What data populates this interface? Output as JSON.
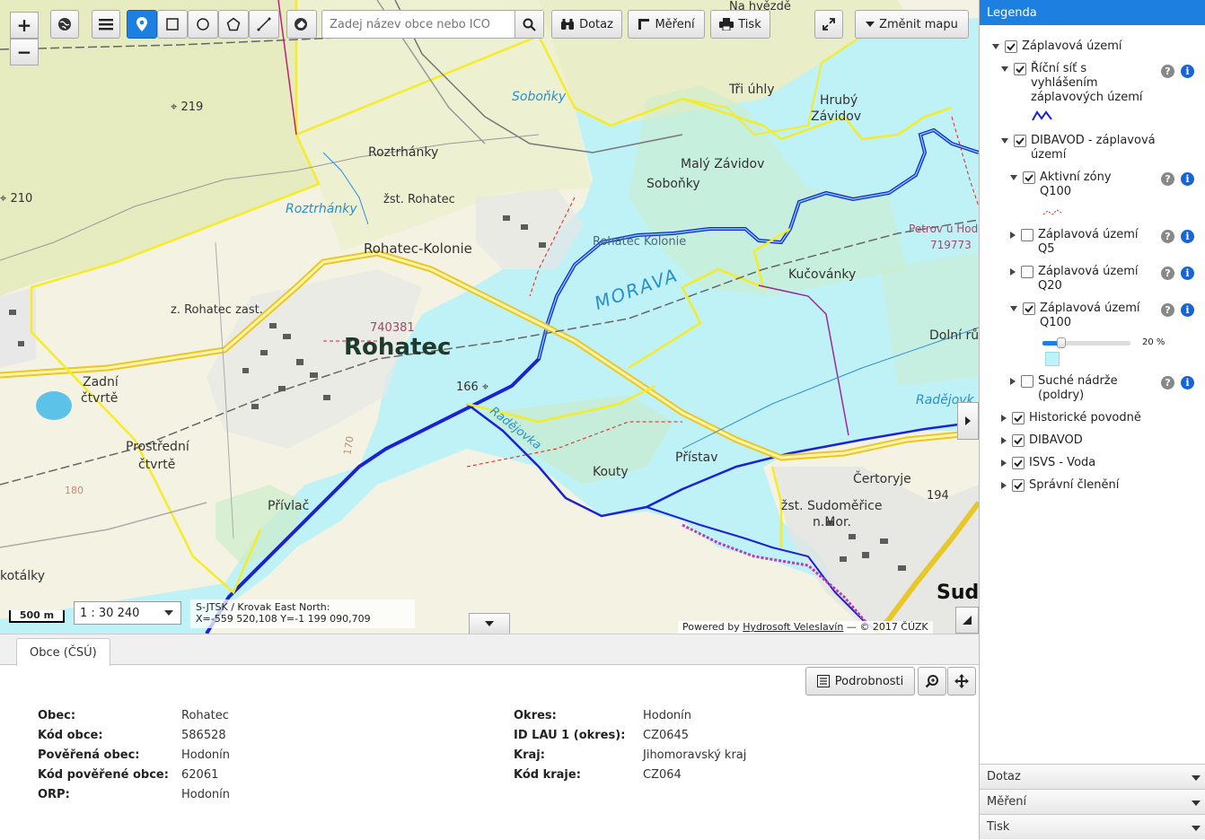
{
  "toolbar": {
    "zoom_in": "+",
    "zoom_out": "−",
    "search_placeholder": "Zadej název obce nebo ICO",
    "query_label": "Dotaz",
    "measure_label": "Měření",
    "print_label": "Tisk",
    "change_map_label": "Změnit mapu",
    "active_tool": "point"
  },
  "map": {
    "labels": {
      "rohatec": "Rohatec",
      "rohatec_code": "740381",
      "rohatec_kolonie": "Rohatec-Kolonie",
      "rohatec_kolonie2": "Rohatec Kolonie",
      "z_rohatec": "z. Rohatec zast.",
      "zst_rohatec": "žst. Rohatec",
      "roztrhanky": "Roztrhánky",
      "roztrhanky_river": "Roztrhánky",
      "sobonky": "Soboňky",
      "sobonky2": "Soboňky",
      "tri_uhly": "Tři úhly",
      "hruby_zavidov": "Hrubý",
      "hruby_zavidov2": "Závidov",
      "maly_zavidov": "Malý Závidov",
      "na_hvezde": "Na hvězdě",
      "petrov": "Petrov u Hodo",
      "petrov_code": "719773",
      "kucovanky": "Kučovánky",
      "dolni_ru": "Dolní rů",
      "morava": "MORAVA",
      "radejovka": "Radějovka",
      "radejovka2": "Radějovk",
      "kouty": "Kouty",
      "pristav": "Přístav",
      "certoryje": "Čertoryje",
      "zst_sudomerice": "žst. Sudoměřice",
      "n_mor": "n.Mor.",
      "sudo": "Sudo",
      "zadni": "Zadní",
      "ctvrte": "čtvrtě",
      "prostredni": "Prostřední",
      "ctvrte2": "čtvrtě",
      "privlac": "Přívlač",
      "kotalky": "kotálky",
      "elev219": "219",
      "elev210": "210",
      "elev166": "166",
      "elev194": "194",
      "elev180": "180",
      "elev170": "170"
    },
    "scale_bar": "500 m",
    "scale_value": "1 : 30 240",
    "crs": "S-JTSK / Krovak East North:",
    "coords": "X=-559 520,108 Y=-1 199 090,709",
    "powered_prefix": "Powered by",
    "powered_link": "Hydrosoft Veleslavín",
    "powered_suffix": "— © 2017 ČÚZK"
  },
  "bottom_panel": {
    "tab": "Obce (ČSÚ)",
    "details_button": "Podrobnosti",
    "left": [
      {
        "key": "Obec",
        "value": "Rohatec"
      },
      {
        "key": "Kód obce",
        "value": "586528"
      },
      {
        "key": "Pověřená obec",
        "value": "Hodonín"
      },
      {
        "key": "Kód pověřené obce",
        "value": "62061"
      },
      {
        "key": "ORP",
        "value": "Hodonín"
      }
    ],
    "right": [
      {
        "key": "Okres",
        "value": "Hodonín"
      },
      {
        "key": "ID LAU 1 (okres)",
        "value": "CZ0645"
      },
      {
        "key": "Kraj",
        "value": "Jihomoravský kraj"
      },
      {
        "key": "Kód kraje",
        "value": "CZ064"
      }
    ]
  },
  "legend": {
    "title": "Legenda",
    "items": {
      "zaplavova_uzemi": "Záplavová území",
      "ricni_sit": "Říční síť s vyhlášením záplavových území",
      "dibavod_zu": "DIBAVOD - záplavová území",
      "aktivni_zony": "Aktivní zóny Q100",
      "zu_q5": "Záplavová území Q5",
      "zu_q20": "Záplavová území Q20",
      "zu_q100": "Záplavová území Q100",
      "opacity": "20 %",
      "opacity_value": 0.2,
      "sucha_nadrze": "Suché nádrže (poldry)",
      "historicke": "Historické povodně",
      "dibavod": "DIBAVOD",
      "isvs": "ISVS - Voda",
      "spravni": "Správní členění"
    },
    "help": "?",
    "info": "i",
    "accordion": [
      "Dotaz",
      "Měření",
      "Tisk"
    ]
  }
}
